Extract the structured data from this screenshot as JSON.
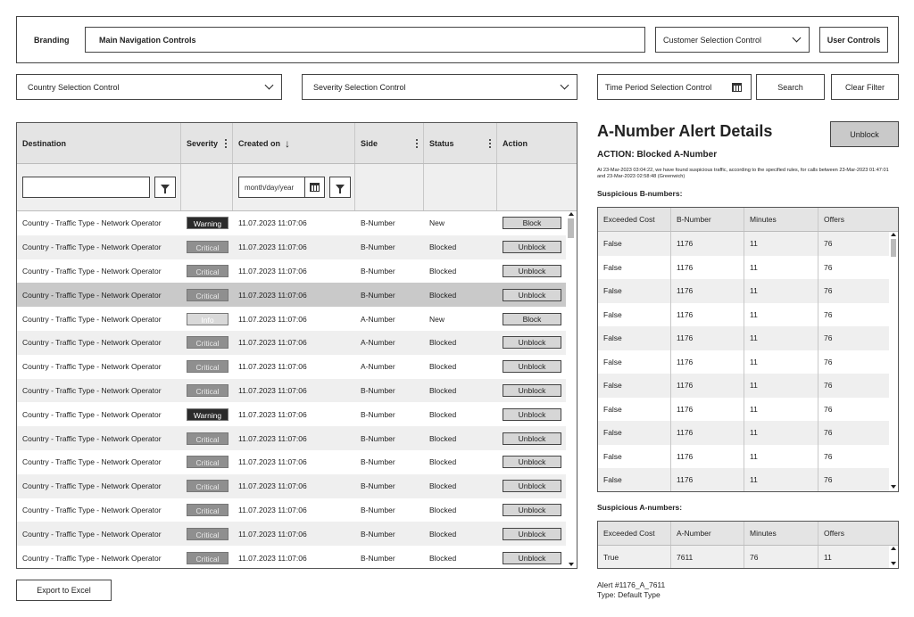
{
  "header": {
    "branding": "Branding",
    "main_nav": "Main Navigation Controls",
    "customer_select": "Customer Selection Control",
    "user_controls": "User Controls"
  },
  "filters": {
    "country": "Country Selection Control",
    "severity": "Severity Selection Control",
    "time_period": "Time Period Selection Control",
    "search": "Search",
    "clear": "Clear Filter"
  },
  "table": {
    "columns": [
      "Destination",
      "Severity",
      "Created on",
      "Side",
      "Status",
      "Action"
    ],
    "date_placeholder": "month/day/year",
    "rows": [
      {
        "destination": "Country - Traffic Type - Network Operator",
        "severity": "Warning",
        "created": "11.07.2023 11:07:06",
        "side": "B-Number",
        "status": "New",
        "action": "Block"
      },
      {
        "destination": "Country - Traffic Type - Network Operator",
        "severity": "Critical",
        "created": "11.07.2023 11:07:06",
        "side": "B-Number",
        "status": "Blocked",
        "action": "Unblock"
      },
      {
        "destination": "Country - Traffic Type - Network Operator",
        "severity": "Critical",
        "created": "11.07.2023 11:07:06",
        "side": "B-Number",
        "status": "Blocked",
        "action": "Unblock"
      },
      {
        "destination": "Country - Traffic Type - Network Operator",
        "severity": "Critical",
        "created": "11.07.2023 11:07:06",
        "side": "B-Number",
        "status": "Blocked",
        "action": "Unblock"
      },
      {
        "destination": "Country - Traffic Type - Network Operator",
        "severity": "Info",
        "created": "11.07.2023 11:07:06",
        "side": "A-Number",
        "status": "New",
        "action": "Block"
      },
      {
        "destination": "Country - Traffic Type - Network Operator",
        "severity": "Critical",
        "created": "11.07.2023 11:07:06",
        "side": "A-Number",
        "status": "Blocked",
        "action": "Unblock"
      },
      {
        "destination": "Country - Traffic Type - Network Operator",
        "severity": "Critical",
        "created": "11.07.2023 11:07:06",
        "side": "A-Number",
        "status": "Blocked",
        "action": "Unblock"
      },
      {
        "destination": "Country - Traffic Type - Network Operator",
        "severity": "Critical",
        "created": "11.07.2023 11:07:06",
        "side": "B-Number",
        "status": "Blocked",
        "action": "Unblock"
      },
      {
        "destination": "Country - Traffic Type - Network Operator",
        "severity": "Warning",
        "created": "11.07.2023 11:07:06",
        "side": "B-Number",
        "status": "Blocked",
        "action": "Unblock"
      },
      {
        "destination": "Country - Traffic Type - Network Operator",
        "severity": "Critical",
        "created": "11.07.2023 11:07:06",
        "side": "B-Number",
        "status": "Blocked",
        "action": "Unblock"
      },
      {
        "destination": "Country - Traffic Type - Network Operator",
        "severity": "Critical",
        "created": "11.07.2023 11:07:06",
        "side": "B-Number",
        "status": "Blocked",
        "action": "Unblock"
      },
      {
        "destination": "Country - Traffic Type - Network Operator",
        "severity": "Critical",
        "created": "11.07.2023 11:07:06",
        "side": "B-Number",
        "status": "Blocked",
        "action": "Unblock"
      },
      {
        "destination": "Country - Traffic Type - Network Operator",
        "severity": "Critical",
        "created": "11.07.2023 11:07:06",
        "side": "B-Number",
        "status": "Blocked",
        "action": "Unblock"
      },
      {
        "destination": "Country - Traffic Type - Network Operator",
        "severity": "Critical",
        "created": "11.07.2023 11:07:06",
        "side": "B-Number",
        "status": "Blocked",
        "action": "Unblock"
      },
      {
        "destination": "Country - Traffic Type - Network Operator",
        "severity": "Critical",
        "created": "11.07.2023 11:07:06",
        "side": "B-Number",
        "status": "Blocked",
        "action": "Unblock"
      }
    ]
  },
  "export_label": "Export to Excel",
  "details": {
    "title": "A-Number Alert Details",
    "unblock": "Unblock",
    "action": "ACTION: Blocked A-Number",
    "description": "At 23-Mar-2023 03:04:22, we have found suspicious traffic, according to the specified rules, for calls between 23-Mar-2023 01:47:01 and 23-Mar-2023 02:58:48 (Greenwich)",
    "b_title": "Suspicious B-numbers:",
    "b_columns": [
      "Exceeded Cost",
      "B-Number",
      "Minutes",
      "Offers"
    ],
    "b_rows": [
      [
        "False",
        "1176",
        "11",
        "76"
      ],
      [
        "False",
        "1176",
        "11",
        "76"
      ],
      [
        "False",
        "1176",
        "11",
        "76"
      ],
      [
        "False",
        "1176",
        "11",
        "76"
      ],
      [
        "False",
        "1176",
        "11",
        "76"
      ],
      [
        "False",
        "1176",
        "11",
        "76"
      ],
      [
        "False",
        "1176",
        "11",
        "76"
      ],
      [
        "False",
        "1176",
        "11",
        "76"
      ],
      [
        "False",
        "1176",
        "11",
        "76"
      ],
      [
        "False",
        "1176",
        "11",
        "76"
      ],
      [
        "False",
        "1176",
        "11",
        "76"
      ]
    ],
    "a_title": "Suspicious A-numbers:",
    "a_columns": [
      "Exceeded Cost",
      "A-Number",
      "Minutes",
      "Offers"
    ],
    "a_rows": [
      [
        "True",
        "7611",
        "76",
        "11"
      ]
    ],
    "alert_id": "Alert #1176_A_7611",
    "alert_type": "Type: Default Type"
  },
  "icons": {
    "chevron": "chevron-down-icon",
    "sort": "arrow-down-icon",
    "menu": "kebab-menu-icon",
    "filter": "funnel-filter-icon",
    "calendar": "calendar-icon"
  }
}
